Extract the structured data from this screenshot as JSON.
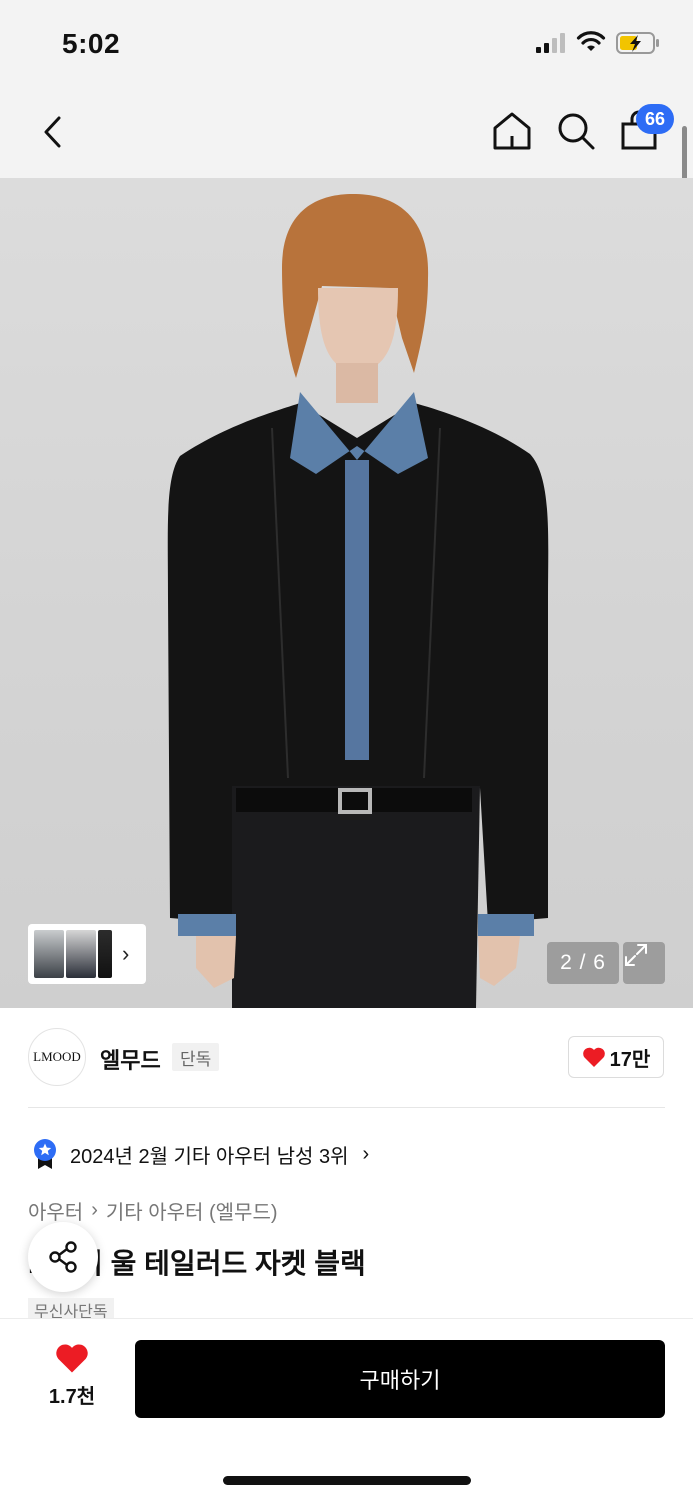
{
  "status_bar": {
    "time": "5:02"
  },
  "nav": {
    "cart_badge": "66",
    "icons": [
      "chevron-left-icon",
      "home-icon",
      "search-icon",
      "bag-icon"
    ]
  },
  "gallery": {
    "counter": "2 / 6",
    "thumb_arrow": "›"
  },
  "brand": {
    "logo_text": "LMOOD",
    "name": "엘무드",
    "tag": "단독",
    "likes": "17만"
  },
  "ranking": {
    "text": "2024년 2월 기타 아우터 남성 3위"
  },
  "breadcrumb": {
    "items": [
      "아우터",
      "기타 아우터 (엘무드)"
    ],
    "separator": "›"
  },
  "product": {
    "title": "...번이 울 테일러드 자켓 블랙",
    "exclusive_tag": "무신사단독"
  },
  "bottom_bar": {
    "like_count": "1.7천",
    "buy_label": "구매하기"
  },
  "colors": {
    "accent_blue": "#2d6cf5",
    "heart_red": "#ec1c24",
    "buy_button": "#000000"
  }
}
